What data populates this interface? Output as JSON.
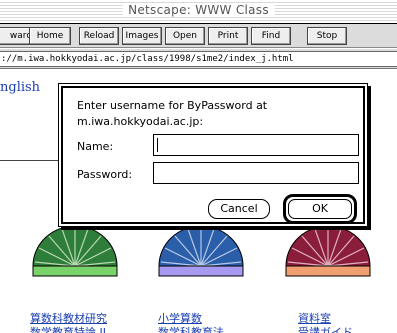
{
  "window": {
    "title": "Netscape: WWW Class"
  },
  "toolbar": {
    "buttons": [
      "ward",
      "Home",
      "Reload",
      "Images",
      "Open",
      "Print",
      "Find",
      "Stop"
    ]
  },
  "location": {
    "url": "://m.iwa.hokkyodai.ac.jp/class/1998/s1me2/index_j.html"
  },
  "page": {
    "english_link": "nglish",
    "domes": [
      {
        "name": "green-dome",
        "dome_color": "#2e7d3a",
        "bar_color": "#7ad36a"
      },
      {
        "name": "blue-dome",
        "dome_color": "#2a5ea8",
        "bar_color": "#a79af0"
      },
      {
        "name": "red-dome",
        "dome_color": "#8a1d3a",
        "bar_color": "#f0a070"
      }
    ],
    "links": [
      {
        "line1": "算数科教材研究",
        "line2": "数学教育特論 II"
      },
      {
        "line1": "小学算数",
        "line2": "数学科教育法"
      },
      {
        "line1": "資料室",
        "line2": "受講ガイド"
      }
    ]
  },
  "dialog": {
    "message_line1": "Enter username for ByPassword at",
    "message_line2": "m.iwa.hokkyodai.ac.jp:",
    "name_label": "Name:",
    "name_value": "",
    "password_label": "Password:",
    "password_value": "",
    "cancel_label": "Cancel",
    "ok_label": "OK"
  }
}
